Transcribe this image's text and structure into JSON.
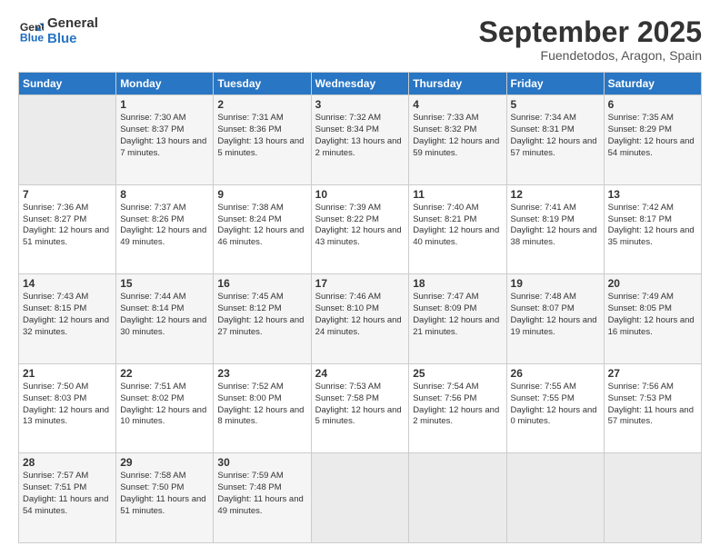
{
  "logo": {
    "line1": "General",
    "line2": "Blue"
  },
  "title": "September 2025",
  "location": "Fuendetodos, Aragon, Spain",
  "weekdays": [
    "Sunday",
    "Monday",
    "Tuesday",
    "Wednesday",
    "Thursday",
    "Friday",
    "Saturday"
  ],
  "weeks": [
    [
      {
        "day": "",
        "empty": true
      },
      {
        "day": "1",
        "sunrise": "Sunrise: 7:30 AM",
        "sunset": "Sunset: 8:37 PM",
        "daylight": "Daylight: 13 hours and 7 minutes."
      },
      {
        "day": "2",
        "sunrise": "Sunrise: 7:31 AM",
        "sunset": "Sunset: 8:36 PM",
        "daylight": "Daylight: 13 hours and 5 minutes."
      },
      {
        "day": "3",
        "sunrise": "Sunrise: 7:32 AM",
        "sunset": "Sunset: 8:34 PM",
        "daylight": "Daylight: 13 hours and 2 minutes."
      },
      {
        "day": "4",
        "sunrise": "Sunrise: 7:33 AM",
        "sunset": "Sunset: 8:32 PM",
        "daylight": "Daylight: 12 hours and 59 minutes."
      },
      {
        "day": "5",
        "sunrise": "Sunrise: 7:34 AM",
        "sunset": "Sunset: 8:31 PM",
        "daylight": "Daylight: 12 hours and 57 minutes."
      },
      {
        "day": "6",
        "sunrise": "Sunrise: 7:35 AM",
        "sunset": "Sunset: 8:29 PM",
        "daylight": "Daylight: 12 hours and 54 minutes."
      }
    ],
    [
      {
        "day": "7",
        "sunrise": "Sunrise: 7:36 AM",
        "sunset": "Sunset: 8:27 PM",
        "daylight": "Daylight: 12 hours and 51 minutes."
      },
      {
        "day": "8",
        "sunrise": "Sunrise: 7:37 AM",
        "sunset": "Sunset: 8:26 PM",
        "daylight": "Daylight: 12 hours and 49 minutes."
      },
      {
        "day": "9",
        "sunrise": "Sunrise: 7:38 AM",
        "sunset": "Sunset: 8:24 PM",
        "daylight": "Daylight: 12 hours and 46 minutes."
      },
      {
        "day": "10",
        "sunrise": "Sunrise: 7:39 AM",
        "sunset": "Sunset: 8:22 PM",
        "daylight": "Daylight: 12 hours and 43 minutes."
      },
      {
        "day": "11",
        "sunrise": "Sunrise: 7:40 AM",
        "sunset": "Sunset: 8:21 PM",
        "daylight": "Daylight: 12 hours and 40 minutes."
      },
      {
        "day": "12",
        "sunrise": "Sunrise: 7:41 AM",
        "sunset": "Sunset: 8:19 PM",
        "daylight": "Daylight: 12 hours and 38 minutes."
      },
      {
        "day": "13",
        "sunrise": "Sunrise: 7:42 AM",
        "sunset": "Sunset: 8:17 PM",
        "daylight": "Daylight: 12 hours and 35 minutes."
      }
    ],
    [
      {
        "day": "14",
        "sunrise": "Sunrise: 7:43 AM",
        "sunset": "Sunset: 8:15 PM",
        "daylight": "Daylight: 12 hours and 32 minutes."
      },
      {
        "day": "15",
        "sunrise": "Sunrise: 7:44 AM",
        "sunset": "Sunset: 8:14 PM",
        "daylight": "Daylight: 12 hours and 30 minutes."
      },
      {
        "day": "16",
        "sunrise": "Sunrise: 7:45 AM",
        "sunset": "Sunset: 8:12 PM",
        "daylight": "Daylight: 12 hours and 27 minutes."
      },
      {
        "day": "17",
        "sunrise": "Sunrise: 7:46 AM",
        "sunset": "Sunset: 8:10 PM",
        "daylight": "Daylight: 12 hours and 24 minutes."
      },
      {
        "day": "18",
        "sunrise": "Sunrise: 7:47 AM",
        "sunset": "Sunset: 8:09 PM",
        "daylight": "Daylight: 12 hours and 21 minutes."
      },
      {
        "day": "19",
        "sunrise": "Sunrise: 7:48 AM",
        "sunset": "Sunset: 8:07 PM",
        "daylight": "Daylight: 12 hours and 19 minutes."
      },
      {
        "day": "20",
        "sunrise": "Sunrise: 7:49 AM",
        "sunset": "Sunset: 8:05 PM",
        "daylight": "Daylight: 12 hours and 16 minutes."
      }
    ],
    [
      {
        "day": "21",
        "sunrise": "Sunrise: 7:50 AM",
        "sunset": "Sunset: 8:03 PM",
        "daylight": "Daylight: 12 hours and 13 minutes."
      },
      {
        "day": "22",
        "sunrise": "Sunrise: 7:51 AM",
        "sunset": "Sunset: 8:02 PM",
        "daylight": "Daylight: 12 hours and 10 minutes."
      },
      {
        "day": "23",
        "sunrise": "Sunrise: 7:52 AM",
        "sunset": "Sunset: 8:00 PM",
        "daylight": "Daylight: 12 hours and 8 minutes."
      },
      {
        "day": "24",
        "sunrise": "Sunrise: 7:53 AM",
        "sunset": "Sunset: 7:58 PM",
        "daylight": "Daylight: 12 hours and 5 minutes."
      },
      {
        "day": "25",
        "sunrise": "Sunrise: 7:54 AM",
        "sunset": "Sunset: 7:56 PM",
        "daylight": "Daylight: 12 hours and 2 minutes."
      },
      {
        "day": "26",
        "sunrise": "Sunrise: 7:55 AM",
        "sunset": "Sunset: 7:55 PM",
        "daylight": "Daylight: 12 hours and 0 minutes."
      },
      {
        "day": "27",
        "sunrise": "Sunrise: 7:56 AM",
        "sunset": "Sunset: 7:53 PM",
        "daylight": "Daylight: 11 hours and 57 minutes."
      }
    ],
    [
      {
        "day": "28",
        "sunrise": "Sunrise: 7:57 AM",
        "sunset": "Sunset: 7:51 PM",
        "daylight": "Daylight: 11 hours and 54 minutes."
      },
      {
        "day": "29",
        "sunrise": "Sunrise: 7:58 AM",
        "sunset": "Sunset: 7:50 PM",
        "daylight": "Daylight: 11 hours and 51 minutes."
      },
      {
        "day": "30",
        "sunrise": "Sunrise: 7:59 AM",
        "sunset": "Sunset: 7:48 PM",
        "daylight": "Daylight: 11 hours and 49 minutes."
      },
      {
        "day": "",
        "empty": true
      },
      {
        "day": "",
        "empty": true
      },
      {
        "day": "",
        "empty": true
      },
      {
        "day": "",
        "empty": true
      }
    ]
  ]
}
